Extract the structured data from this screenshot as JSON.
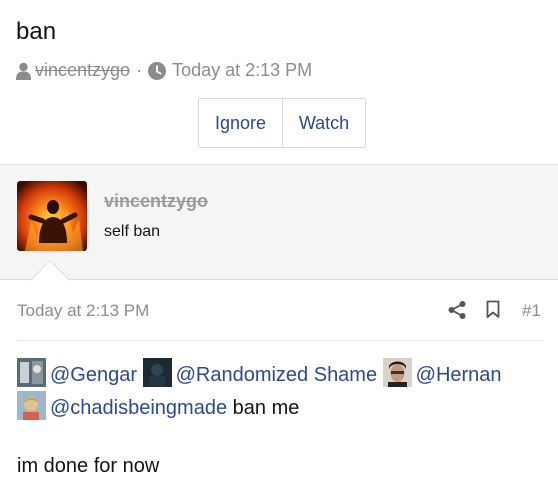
{
  "thread": {
    "title": "ban",
    "author": "vincentzygo",
    "separator": "·",
    "timestamp": "Today at 2:13 PM",
    "actions": {
      "ignore_label": "Ignore",
      "watch_label": "Watch"
    }
  },
  "post": {
    "author": "vincentzygo",
    "user_title": "self ban",
    "date": "Today at 2:13 PM",
    "number": "#1",
    "mentions": [
      {
        "name": "@Gengar",
        "avatar_color": "#5b6a73"
      },
      {
        "name": "@Randomized Shame",
        "avatar_color": "#1d2a33"
      },
      {
        "name": "@Hernan",
        "avatar_color": "#6f5d53"
      },
      {
        "name": "@chadisbeingmade",
        "avatar_color": "#c6a374"
      }
    ],
    "after_mentions": "ban me",
    "body_line": "im done for now"
  },
  "colors": {
    "link": "#2b4a8f",
    "muted": "#8c8c8c",
    "header_bg": "#f5f5f5"
  },
  "icons": [
    "user-icon",
    "clock-icon",
    "share-icon",
    "bookmark-icon"
  ]
}
